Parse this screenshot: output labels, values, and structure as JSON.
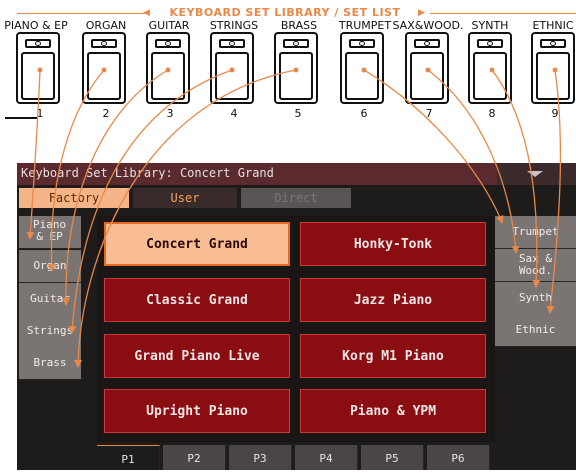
{
  "banner": {
    "text": "KEYBOARD SET LIBRARY / SET LIST"
  },
  "categories": [
    "PIANO & EP",
    "ORGAN",
    "GUITAR",
    "STRINGS",
    "BRASS",
    "TRUMPET",
    "SAX&WOOD.",
    "SYNTH",
    "ETHNIC"
  ],
  "key_numbers": [
    "1",
    "2",
    "3",
    "4",
    "5",
    "6",
    "7",
    "8",
    "9"
  ],
  "screen": {
    "title": "Keyboard Set Library: Concert Grand",
    "tabs": [
      {
        "label": "Factory",
        "state": "selected"
      },
      {
        "label": "User",
        "state": "normal"
      },
      {
        "label": "Direct",
        "state": "disabled"
      }
    ],
    "left_categories": [
      "Piano\n& EP",
      "Organ",
      "Guitar",
      "Strings",
      "Brass"
    ],
    "right_categories": [
      "Trumpet",
      "Sax &\nWood.",
      "Synth",
      "Ethnic"
    ],
    "sounds": [
      {
        "label": "Concert Grand",
        "selected": true
      },
      {
        "label": "Honky-Tonk",
        "selected": false
      },
      {
        "label": "Classic Grand",
        "selected": false
      },
      {
        "label": "Jazz Piano",
        "selected": false
      },
      {
        "label": "Grand Piano Live",
        "selected": false
      },
      {
        "label": "Korg M1 Piano",
        "selected": false
      },
      {
        "label": "Upright Piano",
        "selected": false
      },
      {
        "label": "Piano & YPM",
        "selected": false
      }
    ],
    "pages": [
      "P1",
      "P2",
      "P3",
      "P4",
      "P5",
      "P6"
    ],
    "selected_page": "P1"
  },
  "colors": {
    "accent": "#e8894a",
    "sound_button": "#8a0d12",
    "sound_selected": "#f9bd94",
    "side_button": "#7a7572",
    "title_bar": "#5a2a2e"
  }
}
